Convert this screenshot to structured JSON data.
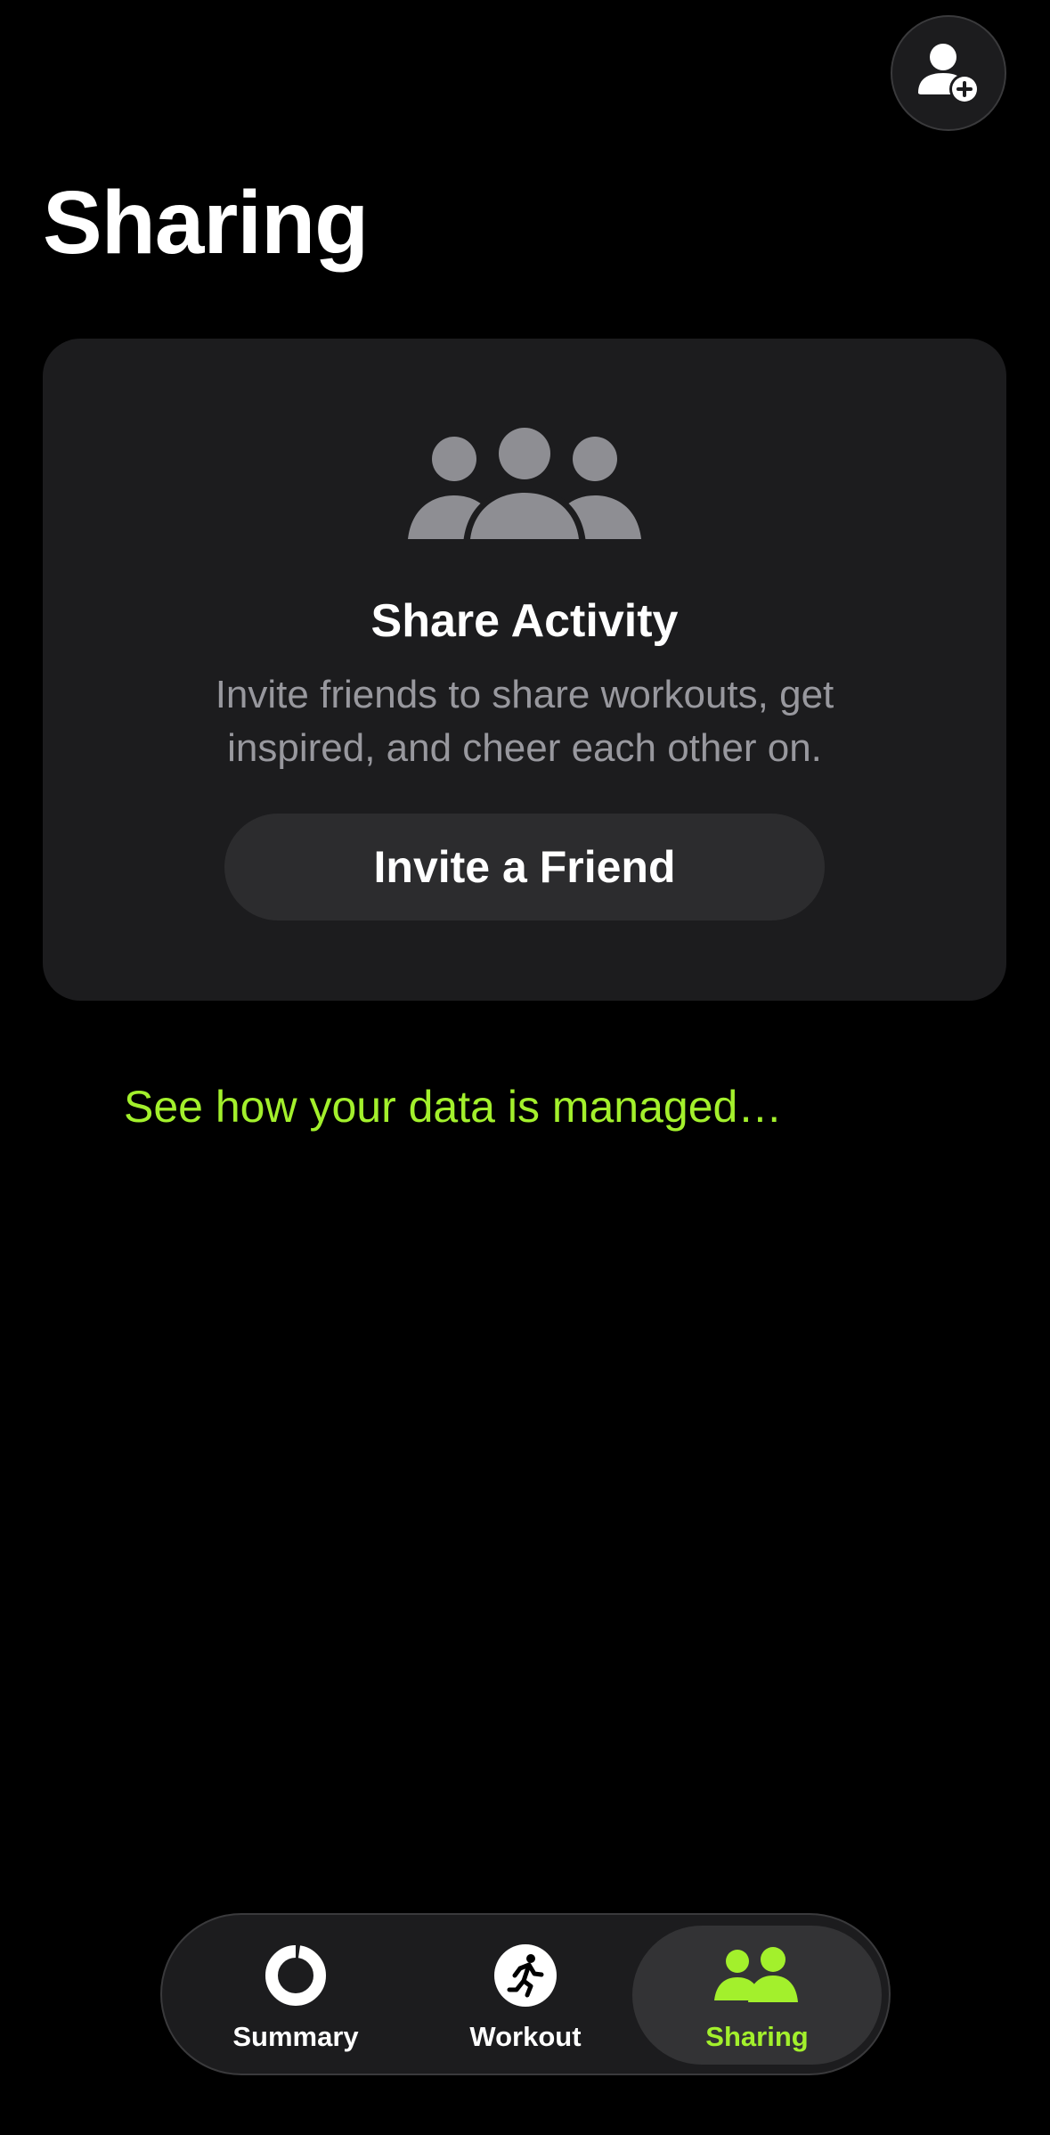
{
  "header": {
    "title": "Sharing",
    "add_friend_icon": "person-add-icon"
  },
  "share_card": {
    "icon": "group-icon",
    "title": "Share Activity",
    "description": "Invite friends to share workouts, get inspired, and cheer each other on.",
    "button_label": "Invite a Friend"
  },
  "data_link": "See how your data is managed…",
  "tab_bar": {
    "items": [
      {
        "label": "Summary",
        "icon": "activity-ring-icon",
        "selected": false
      },
      {
        "label": "Workout",
        "icon": "running-figure-icon",
        "selected": false
      },
      {
        "label": "Sharing",
        "icon": "sharing-people-icon",
        "selected": true
      }
    ]
  },
  "colors": {
    "accent": "#a3f02c",
    "background": "#000000",
    "card": "#1c1c1e",
    "secondary_text": "#98989e"
  }
}
